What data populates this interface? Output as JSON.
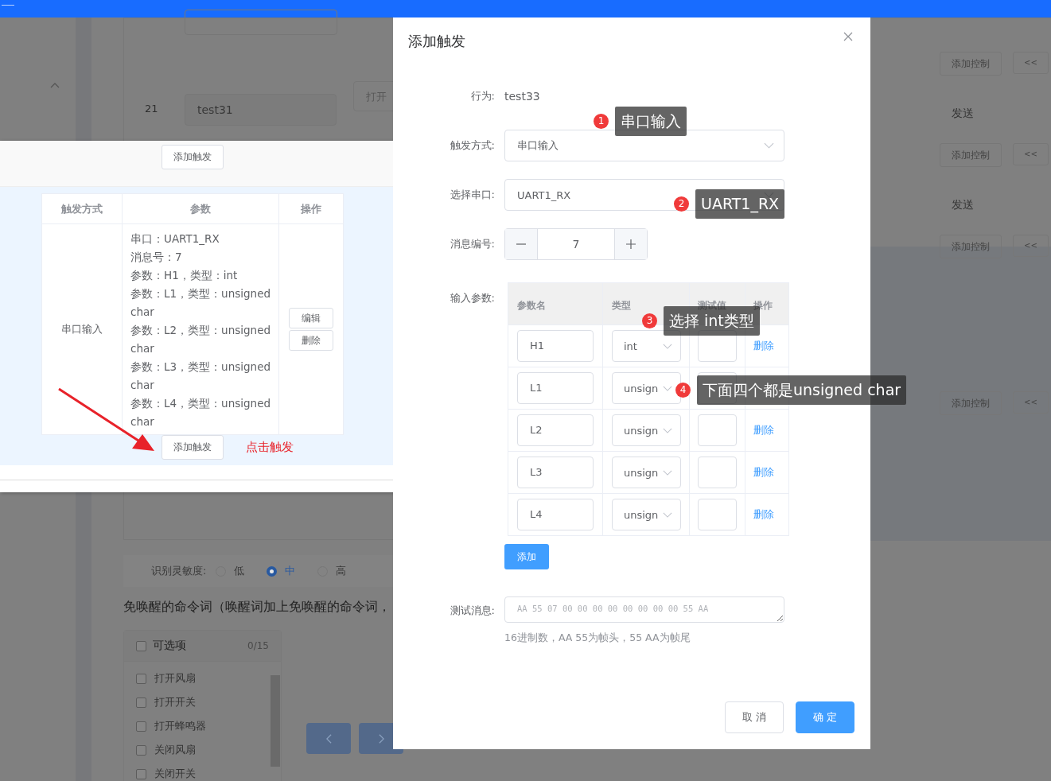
{
  "background": {
    "row": {
      "number": "21",
      "value": "test31",
      "button": "打开"
    },
    "right_rows": [
      {
        "kind": "controls",
        "add": "添加控制",
        "collapse": "<<"
      },
      {
        "kind": "send",
        "label": "发送"
      },
      {
        "kind": "controls",
        "add": "添加控制",
        "collapse": "<<"
      },
      {
        "kind": "send",
        "label": "发送"
      },
      {
        "kind": "controls",
        "add": "添加控制",
        "collapse": "<<"
      },
      {
        "kind": "controls",
        "add": "添加控制",
        "collapse": "<<"
      }
    ],
    "sensitivity": {
      "label": "识别灵敏度:",
      "options": [
        {
          "label": "低",
          "selected": false
        },
        {
          "label": "中",
          "selected": true
        },
        {
          "label": "高",
          "selected": false
        }
      ]
    },
    "command_heading": "免唤醒的命令词（唤醒词加上免唤醒的命令词，",
    "transfer": {
      "title": "可选项",
      "count": "0/15",
      "checked": false,
      "items": [
        {
          "label": "打开风扇",
          "checked": false
        },
        {
          "label": "打开开关",
          "checked": false
        },
        {
          "label": "打开蜂鸣器",
          "checked": false
        },
        {
          "label": "关闭风扇",
          "checked": false
        },
        {
          "label": "关闭开关",
          "checked": false
        }
      ]
    }
  },
  "inset": {
    "top_button": "添加触发",
    "columns": [
      "触发方式",
      "参数",
      "操作"
    ],
    "row": {
      "mode": "串口输入",
      "params": [
        "串口：UART1_RX",
        "消息号：7",
        "参数：H1，类型：int",
        "参数：L1，类型：unsigned char",
        "参数：L2，类型：unsigned char",
        "参数：L3，类型：unsigned char",
        "参数：L4，类型：unsigned char"
      ],
      "actions": [
        "编辑",
        "删除"
      ]
    },
    "bottom_button": "添加触发",
    "callout": "点击触发"
  },
  "dialog": {
    "title": "添加触发",
    "fields": [
      {
        "kind": "text",
        "label": "行为:",
        "value": "test33"
      },
      {
        "kind": "select",
        "label": "触发方式:",
        "value": "串口输入"
      },
      {
        "kind": "select",
        "label": "选择串口:",
        "value": "UART1_RX"
      },
      {
        "kind": "number",
        "label": "消息编号:",
        "value": "7"
      },
      {
        "kind": "params",
        "label": "输入参数:"
      },
      {
        "kind": "textarea",
        "label": "测试消息:",
        "placeholder": "AA 55 07 00 00 00 00 00 00 00 00 55 AA",
        "hint": "16进制数，AA 55为帧头，55 AA为帧尾"
      }
    ],
    "params": {
      "columns": [
        "参数名",
        "类型",
        "测试值",
        "操作"
      ],
      "rows": [
        {
          "name": "H1",
          "type": "int",
          "delete": "删除"
        },
        {
          "name": "L1",
          "type": "unsign"
        },
        {
          "name": "L2",
          "type": "unsign",
          "delete": "删除"
        },
        {
          "name": "L3",
          "type": "unsign",
          "delete": "删除"
        },
        {
          "name": "L4",
          "type": "unsign",
          "delete": "删除"
        }
      ],
      "add_button": "添加"
    },
    "buttons": [
      {
        "label": "取 消",
        "primary": false
      },
      {
        "label": "确 定",
        "primary": true
      }
    ]
  },
  "annotations": [
    {
      "number": "1",
      "text": "串口输入"
    },
    {
      "number": "2",
      "text": "UART1_RX"
    },
    {
      "number": "3",
      "text": "选择 int类型"
    },
    {
      "number": "4",
      "text": "下面四个都是unsigned char"
    }
  ]
}
